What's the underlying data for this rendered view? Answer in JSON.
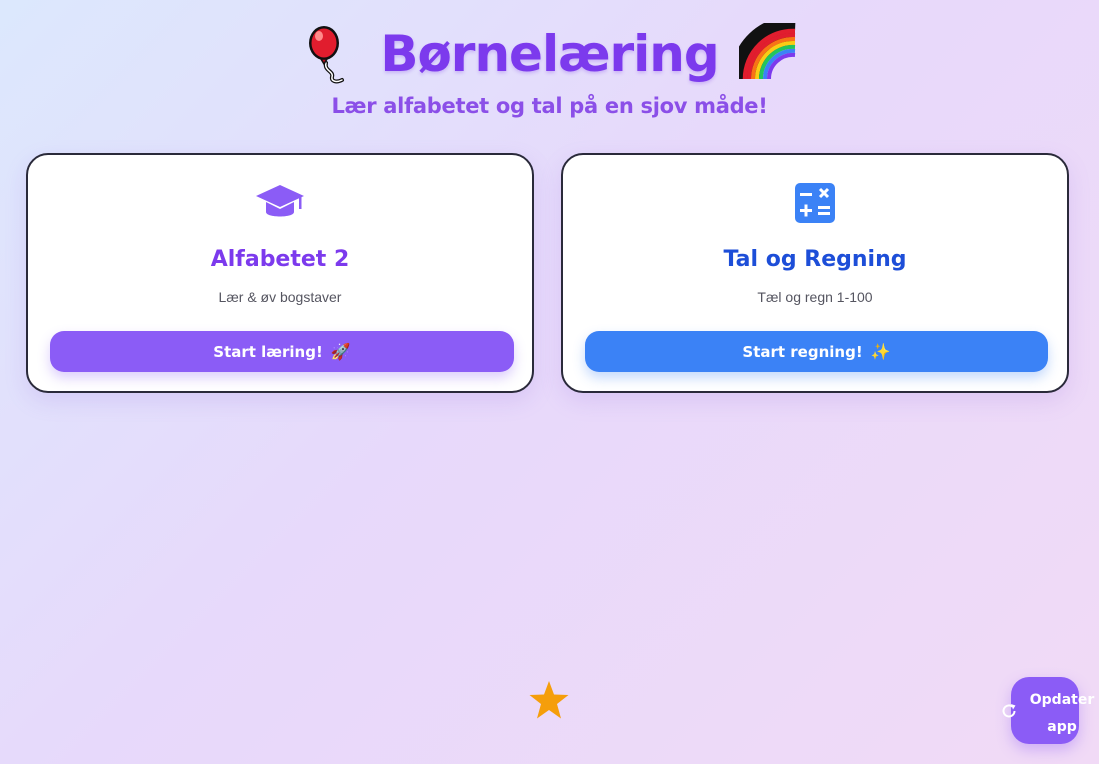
{
  "header": {
    "title": "Børnelæring",
    "subtitle": "Lær alfabetet og tal på en sjov måde!",
    "left_icon": "balloon-icon",
    "right_icon": "rainbow-icon"
  },
  "cards": [
    {
      "icon": "graduation-cap-icon",
      "title": "Alfabetet 2",
      "description": "Lær & øv bogstaver",
      "button_label": "Start læring!",
      "button_emoji": "🚀",
      "accent_color": "#8b5cf6",
      "title_color": "#7c3aed"
    },
    {
      "icon": "calculator-icon",
      "title": "Tal og Regning",
      "description": "Tæl og regn 1-100",
      "button_label": "Start regning!",
      "button_emoji": "✨",
      "accent_color": "#3b82f6",
      "title_color": "#1d4ed8"
    }
  ],
  "footer": {
    "star_icon": "star-icon",
    "update_button_label": "Opdater app",
    "update_icon": "refresh-icon"
  },
  "colors": {
    "primary": "#8b5cf6",
    "secondary": "#3b82f6",
    "star": "#f59e0b"
  }
}
